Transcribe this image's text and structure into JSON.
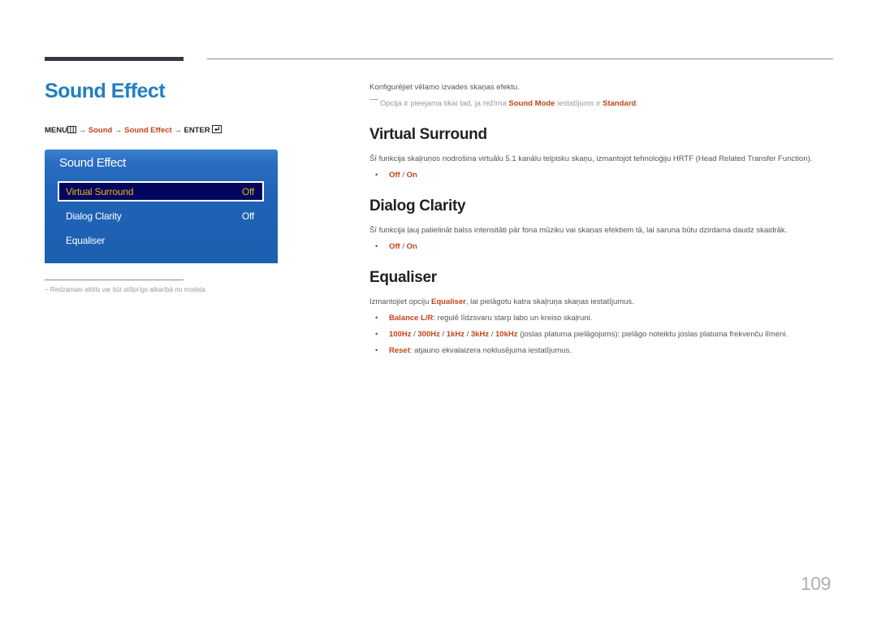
{
  "page": {
    "title": "Sound Effect",
    "page_number": "109"
  },
  "menu_path": {
    "menu": "MENU",
    "menu_icon": "menu-grid-icon",
    "arrow": "→",
    "sound": "Sound",
    "sound_effect": "Sound Effect",
    "enter": "ENTER",
    "enter_icon": "enter-icon"
  },
  "osd": {
    "title": "Sound Effect",
    "items": [
      {
        "label": "Virtual Surround",
        "value": "Off",
        "selected": true
      },
      {
        "label": "Dialog Clarity",
        "value": "Off",
        "selected": false
      },
      {
        "label": "Equaliser",
        "value": "",
        "selected": false
      }
    ]
  },
  "footnote": "−  Redzamais attēls var būt atšķirīgs atkarībā no modeļa.",
  "intro": {
    "text": "Konfigurējiet vēlamo izvades skaņas efektu.",
    "note_pre": "Opcija ir pieejama tikai tad, ja režīma ",
    "note_b1": "Sound Mode",
    "note_mid": " iestatījums ir ",
    "note_b2": "Standard",
    "note_post": "."
  },
  "sections": {
    "virtual_surround": {
      "heading": "Virtual Surround",
      "description": "Šī funkcija skaļruņos nodrošina virtuālu 5.1 kanālu telpisku skaņu, izmantojot tehnoloģiju HRTF (Head Related Transfer Function).",
      "opt_off": "Off",
      "opt_sep": " / ",
      "opt_on": "On"
    },
    "dialog_clarity": {
      "heading": "Dialog Clarity",
      "description": "Šī funkcija ļauj palielināt balss intensitāti pār fona mūziku vai skaņas efektiem tā, lai saruna būtu dzirdama daudz skaidrāk.",
      "opt_off": "Off",
      "opt_sep": " / ",
      "opt_on": "On"
    },
    "equaliser": {
      "heading": "Equaliser",
      "desc_pre": "Izmantojiet opciju ",
      "desc_b": "Equaliser",
      "desc_post": ", lai pielāgotu katra skaļruņa skaņas iestatījumus.",
      "balance_label": "Balance L/R",
      "balance_text": ": regulē līdzsvaru starp labo un kreiso skaļruni.",
      "bands": [
        "100Hz",
        "300Hz",
        "1kHz",
        "3kHz",
        "10kHz"
      ],
      "band_sep": " / ",
      "bands_text": " (joslas platuma pielāgojums): pielāgo noteiktu joslas platuma frekvenču līmeni.",
      "reset_label": "Reset",
      "reset_text": ": atjauno ekvalaizera noklusējuma iestatījumus."
    }
  },
  "bullet": "•",
  "colors": {
    "title_blue": "#1f7fc4",
    "accent_red": "#c0441a",
    "osd_blue": "#1e63b6",
    "osd_selected_bg": "#02065e",
    "osd_selected_text": "#e8b21e"
  }
}
